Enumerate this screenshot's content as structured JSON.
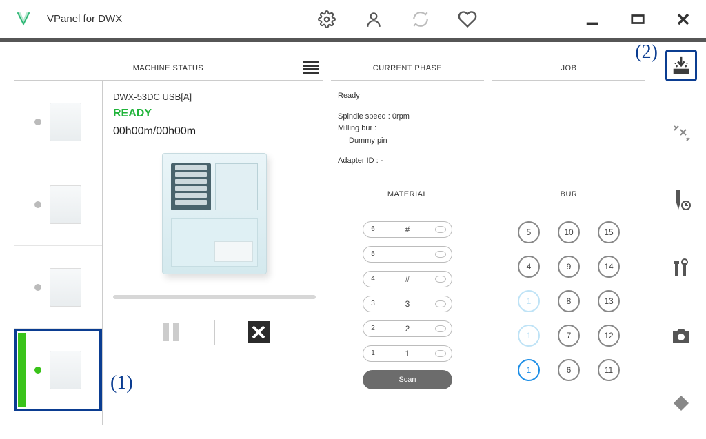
{
  "header": {
    "app_title": "VPanel for DWX"
  },
  "status": {
    "header": "MACHINE STATUS",
    "machine_name": "DWX-53DC USB[A]",
    "state": "READY",
    "time": "00h00m/00h00m"
  },
  "phase": {
    "header": "CURRENT PHASE",
    "status": "Ready",
    "spindle_label": "Spindle speed : 0rpm",
    "milling_bur_label": "Milling bur :",
    "milling_bur_value": "Dummy pin",
    "adapter_label": "Adapter ID : -"
  },
  "job": {
    "header": "JOB"
  },
  "material": {
    "header": "MATERIAL",
    "rows": [
      {
        "slot": "6",
        "value": "#"
      },
      {
        "slot": "5",
        "value": ""
      },
      {
        "slot": "4",
        "value": "#"
      },
      {
        "slot": "3",
        "value": "3"
      },
      {
        "slot": "2",
        "value": "2"
      },
      {
        "slot": "1",
        "value": "1"
      }
    ],
    "scan_label": "Scan"
  },
  "bur": {
    "header": "BUR",
    "cells": [
      {
        "n": "5",
        "state": "normal"
      },
      {
        "n": "10",
        "state": "normal"
      },
      {
        "n": "15",
        "state": "normal"
      },
      {
        "n": "4",
        "state": "normal"
      },
      {
        "n": "9",
        "state": "normal"
      },
      {
        "n": "14",
        "state": "normal"
      },
      {
        "n": "1",
        "state": "empty"
      },
      {
        "n": "8",
        "state": "normal"
      },
      {
        "n": "13",
        "state": "normal"
      },
      {
        "n": "1",
        "state": "empty"
      },
      {
        "n": "7",
        "state": "normal"
      },
      {
        "n": "12",
        "state": "normal"
      },
      {
        "n": "1",
        "state": "selected"
      },
      {
        "n": "6",
        "state": "normal"
      },
      {
        "n": "11",
        "state": "normal"
      }
    ]
  },
  "callouts": {
    "c1": "(1)",
    "c2": "(2)"
  }
}
